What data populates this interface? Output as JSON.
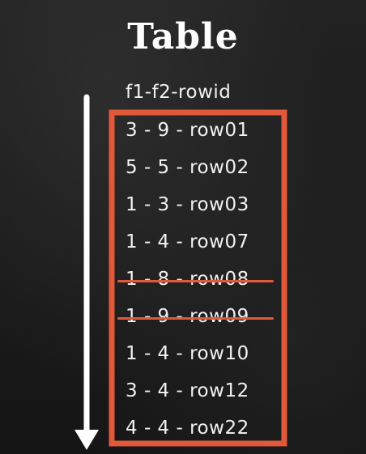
{
  "title": "Table",
  "header": "f1-f2-rowid",
  "colors": {
    "background": "#1b1b1b",
    "text": "#f2f2f2",
    "box": "#e2583a",
    "arrow": "#ffffff"
  },
  "rows": [
    {
      "label": "3 - 9 - row01",
      "struck": false
    },
    {
      "label": "5 - 5 - row02",
      "struck": false
    },
    {
      "label": "1 - 3 - row03",
      "struck": false
    },
    {
      "label": "1 - 4 - row07",
      "struck": false
    },
    {
      "label": "1 - 8 - row08",
      "struck": true
    },
    {
      "label": "1 - 9 - row09",
      "struck": true
    },
    {
      "label": "1 - 4 - row10",
      "struck": false
    },
    {
      "label": "3 - 4 - row12",
      "struck": false
    },
    {
      "label": "4 - 4 - row22",
      "struck": false
    }
  ]
}
